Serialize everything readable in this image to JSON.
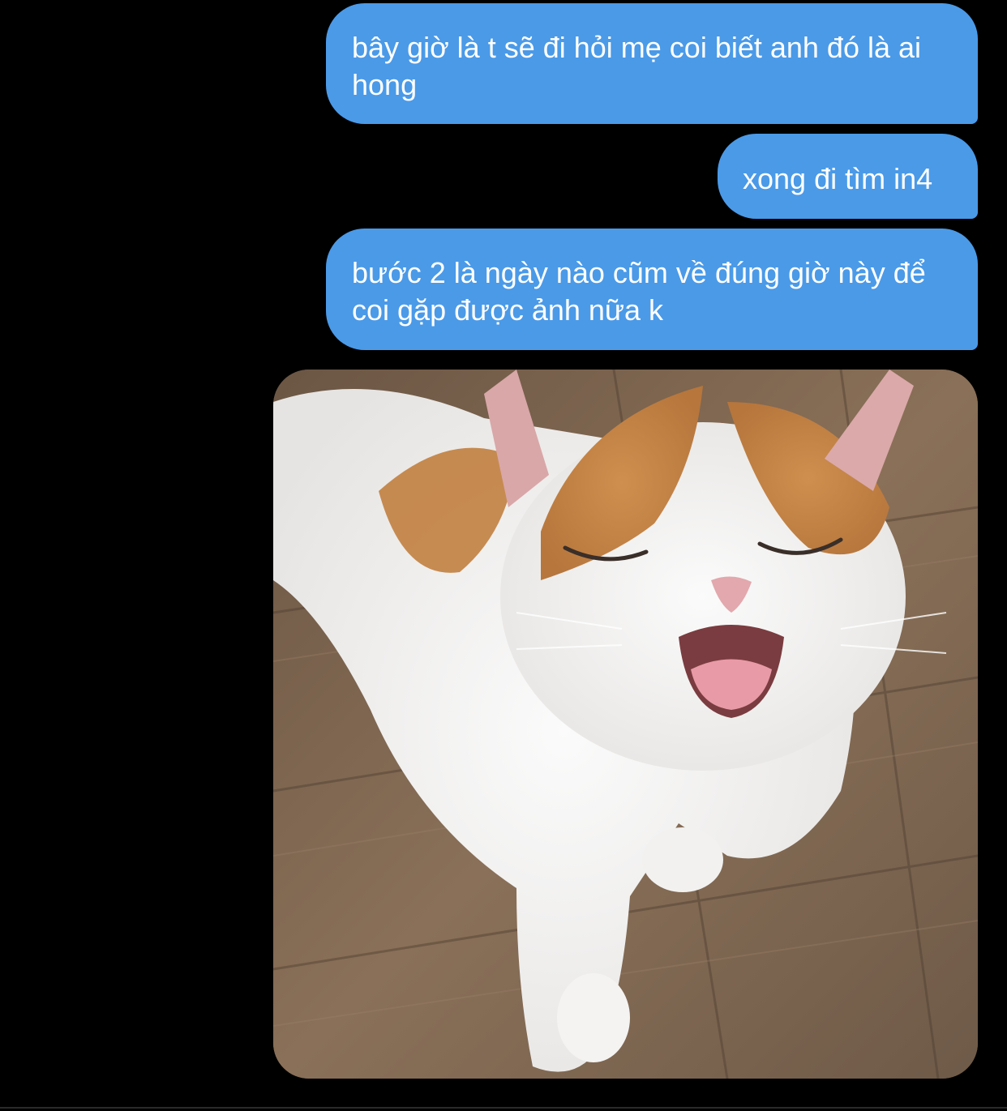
{
  "conversation": {
    "messages": [
      {
        "sender": "me",
        "text": "bây giờ là t sẽ đi hỏi mẹ coi biết anh đó là ai hong"
      },
      {
        "sender": "me",
        "text": "xong đi tìm in4"
      },
      {
        "sender": "me",
        "text": "bước 2 là ngày nào cũm về đúng giờ này để coi gặp được ảnh nữa k"
      }
    ],
    "attachment": {
      "kind": "photo",
      "subject": "smiling-cat"
    }
  },
  "colors": {
    "background": "#000000",
    "bubble": "#4a9ae8",
    "bubble_text": "#ffffff"
  }
}
